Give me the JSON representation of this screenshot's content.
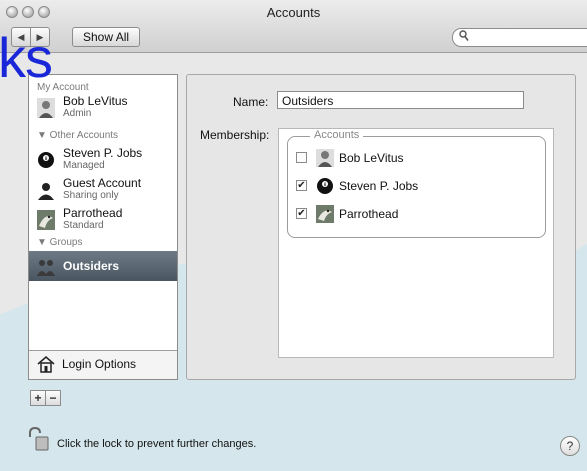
{
  "window": {
    "title": "Accounts"
  },
  "toolbar": {
    "back_icon": "left-arrow-icon",
    "forward_icon": "right-arrow-icon",
    "show_all": "Show All",
    "search_placeholder": ""
  },
  "sidebar": {
    "my_account_header": "My Account",
    "my_account": {
      "name": "Bob LeVitus",
      "role": "Admin"
    },
    "other_accounts_header": "▼ Other Accounts",
    "others": [
      {
        "name": "Steven P. Jobs",
        "role": "Managed"
      },
      {
        "name": "Guest Account",
        "role": "Sharing only"
      },
      {
        "name": "Parrothead",
        "role": "Standard"
      }
    ],
    "groups_header": "▼ Groups",
    "groups": [
      {
        "name": "Outsiders"
      }
    ],
    "login_options": "Login Options",
    "add": "+",
    "remove": "−"
  },
  "detail": {
    "name_label": "Name:",
    "name_value": "Outsiders",
    "membership_label": "Membership:",
    "accounts_legend": "Accounts",
    "members": [
      {
        "name": "Bob LeVitus",
        "checked": false,
        "mark": ""
      },
      {
        "name": "Steven P. Jobs",
        "checked": true,
        "mark": "✔"
      },
      {
        "name": "Parrothead",
        "checked": true,
        "mark": "✔"
      }
    ]
  },
  "footer": {
    "lock_text": "Click the lock to prevent further changes.",
    "help": "?"
  },
  "watermark": {
    "text": "ks",
    "color": "#1a27d8",
    "band_color": "#cfe7ee"
  }
}
